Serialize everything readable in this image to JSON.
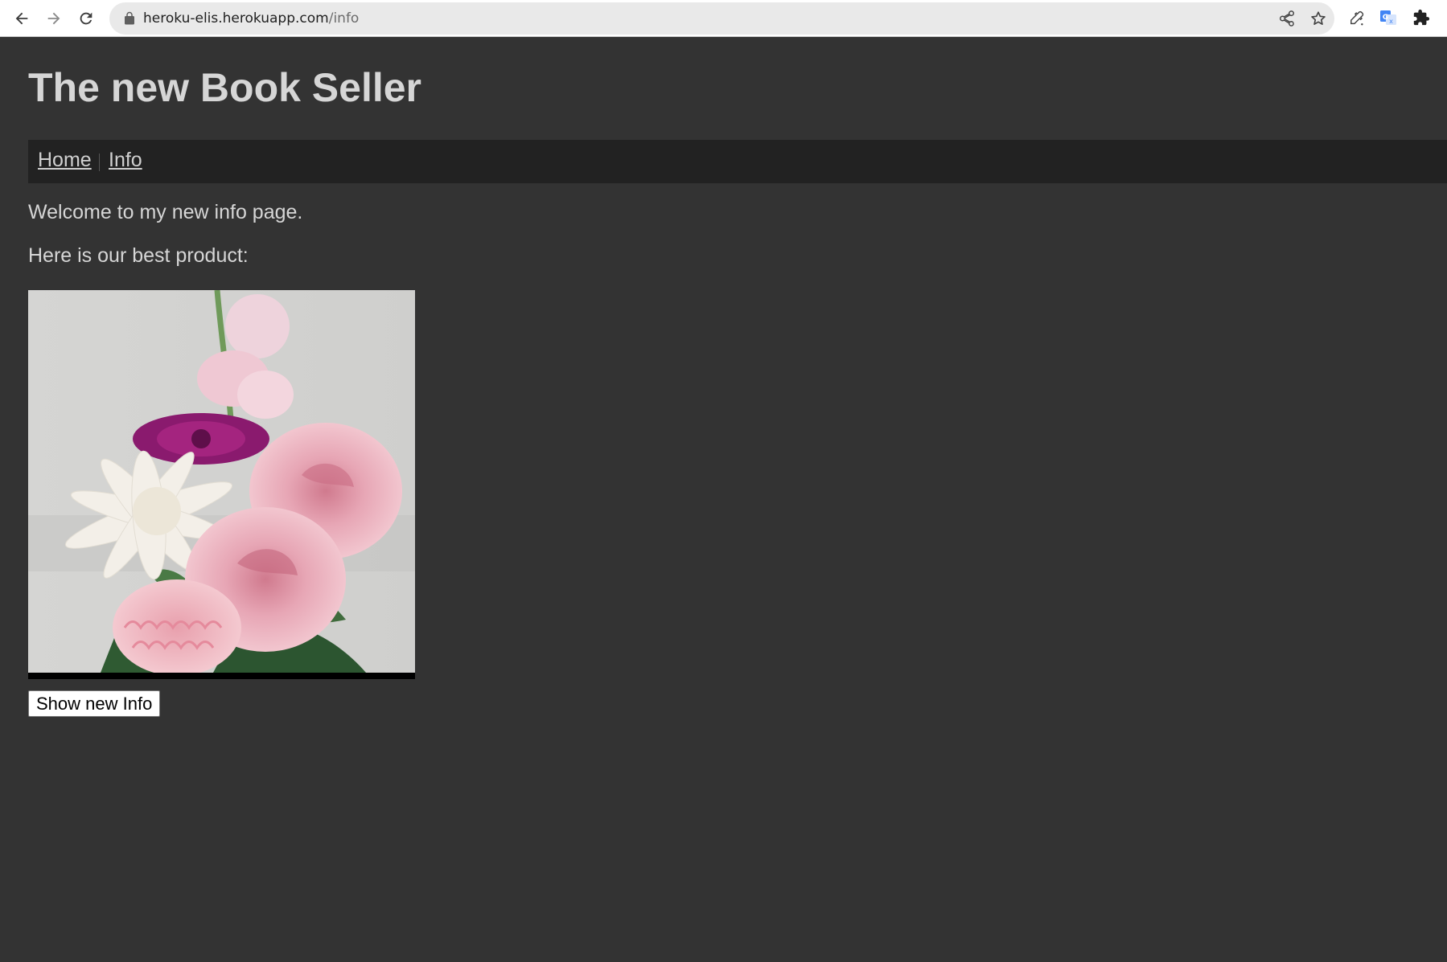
{
  "browser": {
    "url_host": "heroku-elis.herokuapp.com",
    "url_path": "/info",
    "icons": [
      "back-icon",
      "forward-icon",
      "reload-icon",
      "lock-icon",
      "share-icon",
      "bookmark-star-icon",
      "eyedropper-extension-icon",
      "translate-extension-icon",
      "extensions-puzzle-icon"
    ]
  },
  "page": {
    "title": "The new Book Seller",
    "nav": {
      "home": "Home",
      "info": "Info"
    },
    "welcome": "Welcome to my new info page.",
    "best_product": "Here is our best product:",
    "product_image_alt": "flower-bouquet",
    "button_label": "Show new Info"
  },
  "colors": {
    "background": "#333333",
    "navbar": "#222222",
    "text": "#d6d6d6"
  }
}
